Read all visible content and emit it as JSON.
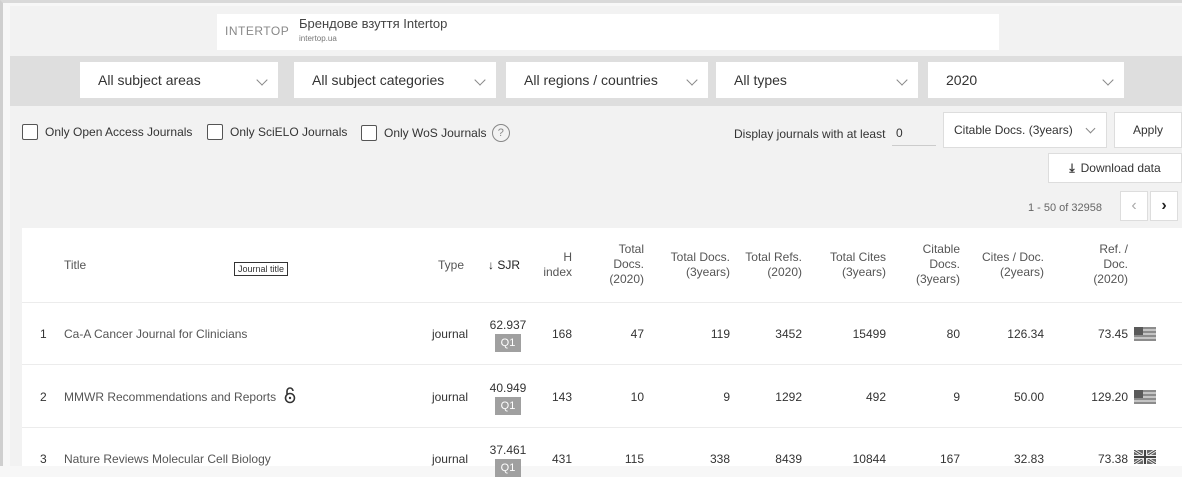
{
  "ad": {
    "brand": "INTERTOP",
    "title": "Брендове взуття Intertop",
    "url": "intertop.ua"
  },
  "filters": {
    "subject_areas": "All subject areas",
    "subject_categories": "All subject categories",
    "regions": "All regions / countries",
    "types": "All types",
    "year": "2020"
  },
  "checkboxes": {
    "open_access": "Only Open Access Journals",
    "scielo": "Only SciELO Journals",
    "wos": "Only WoS Journals",
    "help_icon": "?"
  },
  "threshold": {
    "label": "Display journals with at least",
    "value": "0",
    "metric": "Citable Docs. (3years)",
    "apply": "Apply"
  },
  "download": {
    "label": "Download data",
    "icon": "download-icon"
  },
  "pager": {
    "range": "1 - 50 of 32958",
    "prev": "‹",
    "next": "›"
  },
  "table": {
    "tooltip": "Journal title",
    "headers": {
      "title": "Title",
      "type": "Type",
      "sjr": "↓ SJR",
      "h_index": [
        "H",
        "index"
      ],
      "total_docs": [
        "Total",
        "Docs.",
        "(2020)"
      ],
      "total_docs_3y": [
        "Total Docs.",
        "(3years)"
      ],
      "total_refs": [
        "Total Refs.",
        "(2020)"
      ],
      "total_cites": [
        "Total Cites",
        "(3years)"
      ],
      "citable_docs": [
        "Citable",
        "Docs.",
        "(3years)"
      ],
      "cites_doc": [
        "Cites / Doc.",
        "(2years)"
      ],
      "ref_doc": [
        "Ref. /",
        "Doc.",
        "(2020)"
      ]
    },
    "rows": [
      {
        "rank": "1",
        "title": "Ca-A Cancer Journal for Clinicians",
        "open_access": false,
        "type": "journal",
        "sjr": "62.937",
        "quartile": "Q1",
        "h_index": "168",
        "total_docs": "47",
        "total_docs_3y": "119",
        "total_refs": "3452",
        "total_cites": "15499",
        "citable_docs": "80",
        "cites_doc": "126.34",
        "ref_doc": "73.45",
        "country_flag": "us-flag-icon"
      },
      {
        "rank": "2",
        "title": "MMWR Recommendations and Reports",
        "open_access": true,
        "type": "journal",
        "sjr": "40.949",
        "quartile": "Q1",
        "h_index": "143",
        "total_docs": "10",
        "total_docs_3y": "9",
        "total_refs": "1292",
        "total_cites": "492",
        "citable_docs": "9",
        "cites_doc": "50.00",
        "ref_doc": "129.20",
        "country_flag": "us-flag-icon"
      },
      {
        "rank": "3",
        "title": "Nature Reviews Molecular Cell Biology",
        "open_access": false,
        "type": "journal",
        "sjr": "37.461",
        "quartile": "Q1",
        "h_index": "431",
        "total_docs": "115",
        "total_docs_3y": "338",
        "total_refs": "8439",
        "total_cites": "10844",
        "citable_docs": "167",
        "cites_doc": "32.83",
        "ref_doc": "73.38",
        "country_flag": "uk-flag-icon"
      }
    ]
  }
}
